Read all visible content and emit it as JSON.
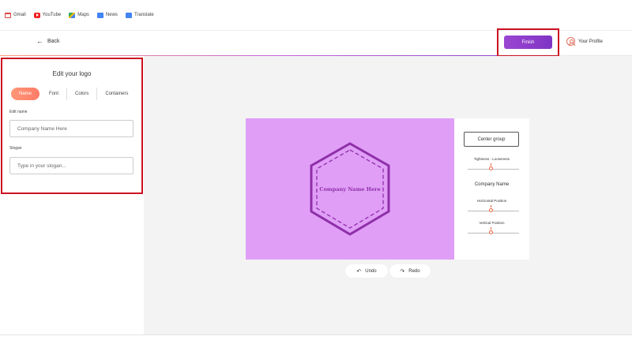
{
  "bookmarks": [
    {
      "label": "Gmail",
      "icon": "gmail-icon"
    },
    {
      "label": "YouTube",
      "icon": "youtube-icon"
    },
    {
      "label": "Maps",
      "icon": "maps-icon"
    },
    {
      "label": "News",
      "icon": "news-icon"
    },
    {
      "label": "Translate",
      "icon": "translate-icon"
    }
  ],
  "header": {
    "back_label": "Back",
    "finish_label": "Finish",
    "profile_label": "Your Profile",
    "progress_fraction": 0.87
  },
  "editor": {
    "title": "Edit your logo",
    "tabs": [
      {
        "label": "Name",
        "active": true
      },
      {
        "label": "Font",
        "active": false
      },
      {
        "label": "Colors",
        "active": false
      },
      {
        "label": "Containers",
        "active": false
      }
    ],
    "name_label": "Edit name",
    "name_placeholder": "Company Name Here",
    "slogan_label": "Slogan",
    "slogan_placeholder": "Type in your slogan..."
  },
  "preview": {
    "logo_text": "Company Name Here",
    "background_color": "#e09ef7",
    "shape_color": "#8e2fa8"
  },
  "controls": {
    "center_group_label": "Center group",
    "tightness_label": "Tightness - Looseness",
    "section_label": "Company Name",
    "horizontal_label": "Horizontal Position",
    "vertical_label": "Vertical Position"
  },
  "history": {
    "undo_label": "Undo",
    "redo_label": "Redo"
  },
  "colors": {
    "accent_gradient_start": "#ff9877",
    "accent_gradient_end": "#8034c4",
    "highlight_border": "#cc1122"
  }
}
